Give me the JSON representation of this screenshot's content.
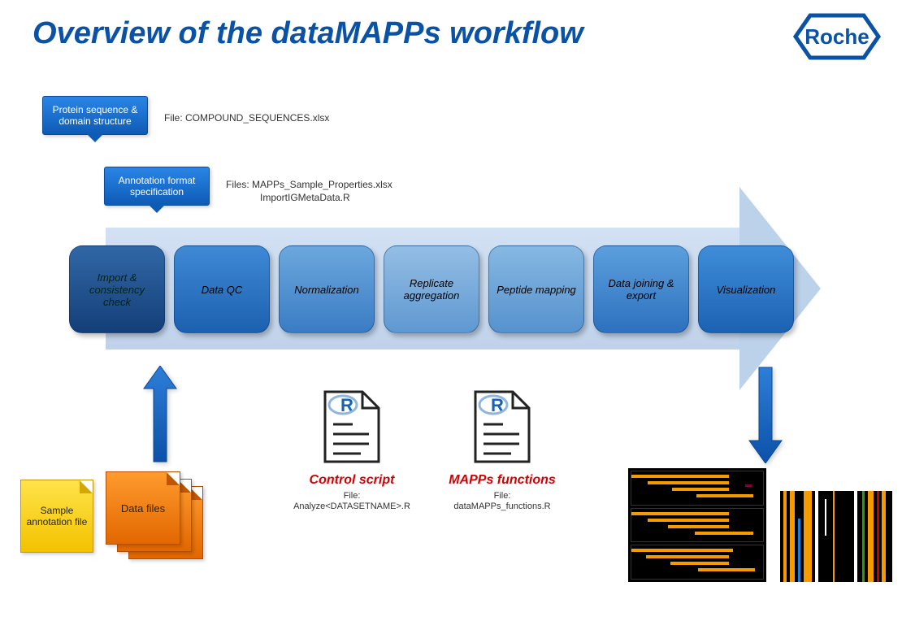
{
  "title": "Overview of the dataMAPPs workflow",
  "logo_text": "Roche",
  "callouts": {
    "protein": "Protein sequence & domain structure",
    "annotation": "Annotation format specification"
  },
  "file_labels": {
    "protein": "File: COMPOUND_SEQUENCES.xlsx",
    "annotation_line1": "Files: MAPPs_Sample_Properties.xlsx",
    "annotation_line2": "ImportIGMetaData.R"
  },
  "steps": {
    "s1": "Import & consistency check",
    "s2": "Data QC",
    "s3": "Normalization",
    "s4": "Replicate aggregation",
    "s5": "Peptide mapping",
    "s6": "Data joining & export",
    "s7": "Visualization"
  },
  "inputs": {
    "sample_annotation": "Sample annotation file",
    "data_files": "Data files"
  },
  "rfiles": {
    "control_title": "Control script",
    "control_sub1": "File:",
    "control_sub2": "Analyze<DATASETNAME>.R",
    "mapps_title": "MAPPs functions",
    "mapps_sub1": "File:",
    "mapps_sub2": "dataMAPPs_functions.R"
  }
}
